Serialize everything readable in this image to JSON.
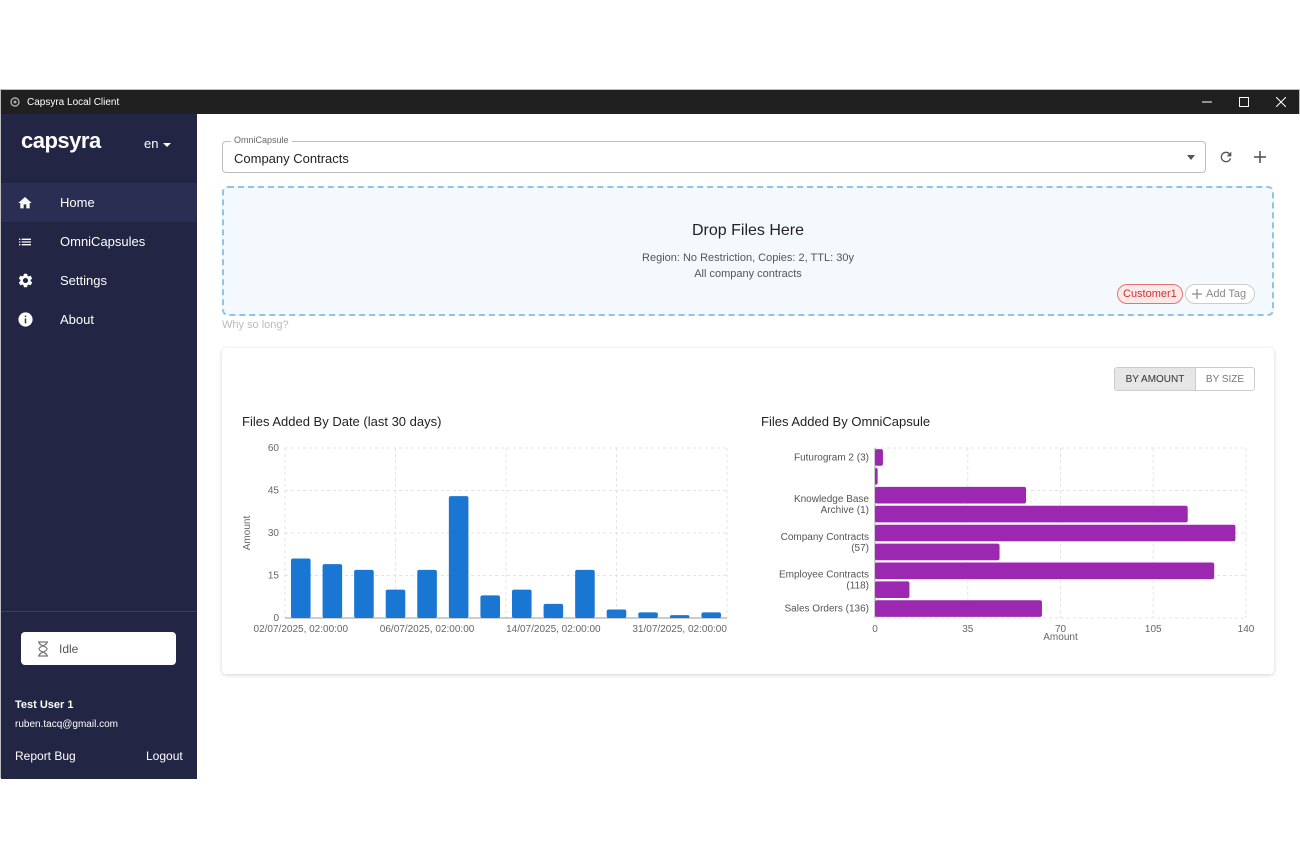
{
  "window": {
    "title": "Capsyra Local Client",
    "controls": [
      "minimize-icon",
      "maximize-icon",
      "close-icon"
    ]
  },
  "sidebar": {
    "logo": "capsyra",
    "language": "en",
    "items": [
      {
        "label": "Home",
        "icon": "home-icon",
        "active": true
      },
      {
        "label": "OmniCapsules",
        "icon": "list-icon",
        "active": false
      },
      {
        "label": "Settings",
        "icon": "gear-icon",
        "active": false
      },
      {
        "label": "About",
        "icon": "info-icon",
        "active": false
      }
    ],
    "status": {
      "label": "Idle",
      "icon": "hourglass-icon"
    },
    "user": {
      "name": "Test User 1",
      "email": "ruben.tacq@gmail.com"
    },
    "report_bug": "Report Bug",
    "logout": "Logout"
  },
  "capsule_select": {
    "label": "OmniCapsule",
    "value": "Company Contracts"
  },
  "dropzone": {
    "title": "Drop Files Here",
    "details": "Region: No Restriction, Copies: 2, TTL: 30y",
    "description": "All company contracts",
    "tags": [
      "Customer1"
    ],
    "add_tag_label": "Add Tag"
  },
  "why_so_long": "Why so long?",
  "stats": {
    "toggle": {
      "by_amount": "BY AMOUNT",
      "by_size": "BY SIZE",
      "selected": "BY AMOUNT"
    }
  },
  "colors": {
    "sidebar_bg": "#222543",
    "bar_blue": "#1976d2",
    "bar_purple": "#9c27b0",
    "tag_red": "#d32f2f"
  },
  "chart_data": [
    {
      "type": "bar",
      "title": "Files Added By Date (last 30 days)",
      "ylabel": "Amount",
      "xlabel": "",
      "ylim": [
        0,
        60
      ],
      "yticks": [
        0,
        15,
        30,
        45,
        60
      ],
      "x_tick_labels": [
        "02/07/2025, 02:00:00",
        "06/07/2025, 02:00:00",
        "14/07/2025, 02:00:00",
        "31/07/2025, 02:00:00"
      ],
      "values": [
        21,
        19,
        17,
        10,
        17,
        43,
        8,
        10,
        5,
        17,
        3,
        2,
        1,
        2
      ],
      "color": "#1976d2",
      "grid": true
    },
    {
      "type": "bar",
      "orientation": "horizontal",
      "title": "Files Added By OmniCapsule",
      "xlabel": "Amount",
      "ylabel": "",
      "xlim": [
        0,
        140
      ],
      "xticks": [
        0,
        35,
        70,
        105,
        140
      ],
      "category_labels": [
        "Futurogram 2 (3)",
        "Knowledge Base Archive (1)",
        "Company Contracts (57)",
        "Employee Contracts (118)",
        "Sales Orders (136)"
      ],
      "values": [
        3,
        1,
        57,
        118,
        136,
        47,
        128,
        13,
        63
      ],
      "color": "#9c27b0",
      "grid": true
    }
  ]
}
